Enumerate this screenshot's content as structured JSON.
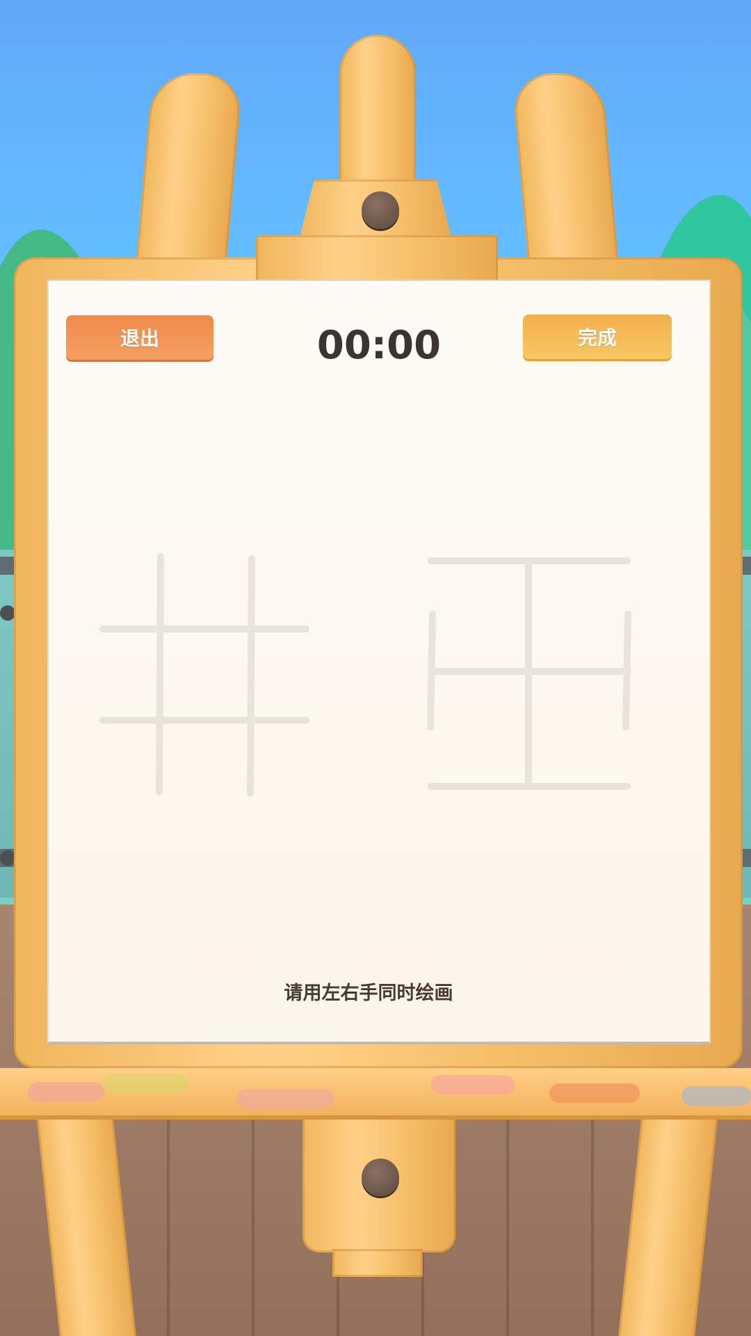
{
  "header": {
    "exit_label": "退出",
    "timer": "00:00",
    "done_label": "完成"
  },
  "canvas": {
    "left_pattern": "hash-grid",
    "right_pattern": "nested-square-grid",
    "instruction": "请用左右手同时绘画"
  },
  "colors": {
    "exit_button": "#f28a4a",
    "done_button": "#f2b04a",
    "paper": "#fdfaf3",
    "guide_lines": "#e8e4dc",
    "easel_wood": "#f6c06b"
  }
}
